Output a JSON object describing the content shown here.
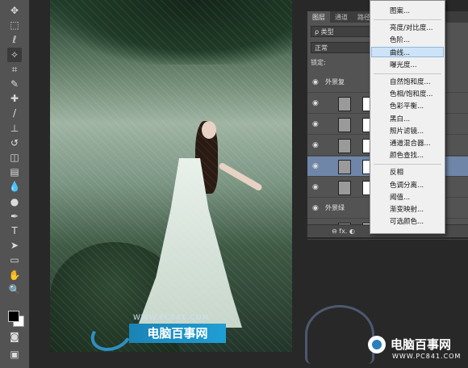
{
  "toolbar": {
    "tools": [
      {
        "name": "move-tool-icon",
        "glyph": "✥"
      },
      {
        "name": "marquee-tool-icon",
        "glyph": "⬚"
      },
      {
        "name": "lasso-tool-icon",
        "glyph": "ℓ"
      },
      {
        "name": "magic-wand-tool-icon",
        "glyph": "✧"
      },
      {
        "name": "crop-tool-icon",
        "glyph": "⌗"
      },
      {
        "name": "eyedropper-tool-icon",
        "glyph": "✎"
      },
      {
        "name": "healing-brush-tool-icon",
        "glyph": "✚"
      },
      {
        "name": "brush-tool-icon",
        "glyph": "/"
      },
      {
        "name": "clone-stamp-tool-icon",
        "glyph": "⊥"
      },
      {
        "name": "history-brush-tool-icon",
        "glyph": "↺"
      },
      {
        "name": "eraser-tool-icon",
        "glyph": "◫"
      },
      {
        "name": "gradient-tool-icon",
        "glyph": "▤"
      },
      {
        "name": "blur-tool-icon",
        "glyph": "💧"
      },
      {
        "name": "dodge-tool-icon",
        "glyph": "●"
      },
      {
        "name": "pen-tool-icon",
        "glyph": "✒"
      },
      {
        "name": "type-tool-icon",
        "glyph": "T"
      },
      {
        "name": "path-selection-tool-icon",
        "glyph": "➤"
      },
      {
        "name": "shape-tool-icon",
        "glyph": "▭"
      },
      {
        "name": "hand-tool-icon",
        "glyph": "✋"
      },
      {
        "name": "zoom-tool-icon",
        "glyph": "🔍"
      }
    ],
    "extra": [
      {
        "name": "quick-mask-icon",
        "glyph": "◙"
      },
      {
        "name": "screen-mode-icon",
        "glyph": "▣"
      }
    ]
  },
  "canvas": {
    "watermark_url": "WWW.PC841.COM",
    "watermark_text": "电脑百事网"
  },
  "layers_panel": {
    "tabs": [
      "图层",
      "通道",
      "路径"
    ],
    "filter_label": "ρ 类型",
    "blend_mode": "正常",
    "lock_label": "锁定:",
    "layers": [
      {
        "label": "外景复",
        "type": "group",
        "selected": false
      },
      {
        "label": "",
        "type": "adjustment",
        "selected": false
      },
      {
        "label": "",
        "type": "curves",
        "selected": false
      },
      {
        "label": "",
        "type": "curves",
        "selected": false
      },
      {
        "label": "",
        "type": "balance",
        "selected": true
      },
      {
        "label": "",
        "type": "layer",
        "selected": false
      },
      {
        "label": "外景绿",
        "type": "group",
        "selected": false
      },
      {
        "label": "背景 拷贝",
        "type": "layer",
        "selected": false
      }
    ],
    "footer": "⊖  fx.  ◐"
  },
  "adjust_menu": {
    "items": [
      {
        "label": "图案...",
        "group": 1
      },
      {
        "label": "亮度/对比度...",
        "group": 2
      },
      {
        "label": "色阶...",
        "group": 2
      },
      {
        "label": "曲线...",
        "group": 2,
        "highlight": true
      },
      {
        "label": "曝光度...",
        "group": 2
      },
      {
        "label": "自然饱和度...",
        "group": 3
      },
      {
        "label": "色相/饱和度...",
        "group": 3
      },
      {
        "label": "色彩平衡...",
        "group": 3
      },
      {
        "label": "黑白...",
        "group": 3
      },
      {
        "label": "照片滤镜...",
        "group": 3
      },
      {
        "label": "通道混合器...",
        "group": 3
      },
      {
        "label": "颜色查找...",
        "group": 3
      },
      {
        "label": "反相",
        "group": 4
      },
      {
        "label": "色调分离...",
        "group": 4
      },
      {
        "label": "阈值...",
        "group": 4
      },
      {
        "label": "渐变映射...",
        "group": 4
      },
      {
        "label": "可选颜色...",
        "group": 4
      }
    ]
  },
  "corner_watermark": {
    "title": "电脑百事网",
    "url": "WWW.PC841.COM"
  },
  "colors": {
    "panel_bg": "#535353",
    "selected_layer": "#6f86a8",
    "menu_highlight": "#cde3f7",
    "watermark_blue": "#1e9fd5"
  }
}
